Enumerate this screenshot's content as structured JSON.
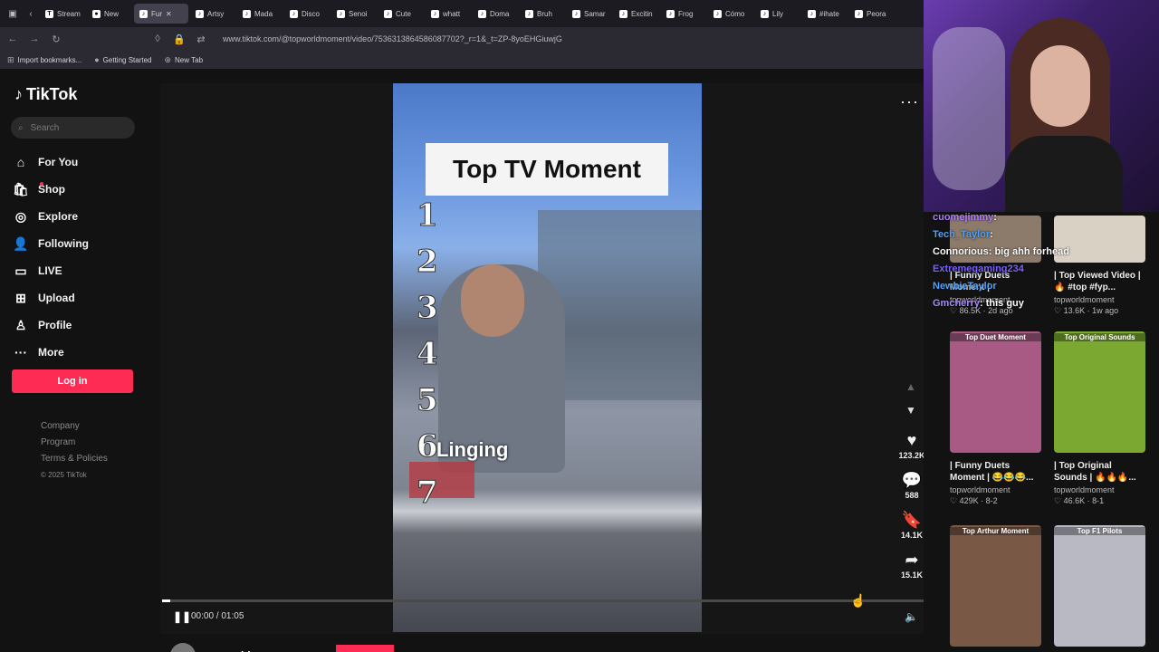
{
  "browser": {
    "tabs": [
      {
        "label": "Stream",
        "fav": "T"
      },
      {
        "label": "New",
        "fav": "●"
      },
      {
        "label": "Fur",
        "fav": "♪",
        "active": true
      },
      {
        "label": "Artsy",
        "fav": "♪"
      },
      {
        "label": "Mada",
        "fav": "♪"
      },
      {
        "label": "Disco",
        "fav": "♪"
      },
      {
        "label": "Senoi",
        "fav": "♪"
      },
      {
        "label": "Cute",
        "fav": "♪"
      },
      {
        "label": "whatt",
        "fav": "♪"
      },
      {
        "label": "Doma",
        "fav": "♪"
      },
      {
        "label": "Bruh",
        "fav": "♪"
      },
      {
        "label": "Samar",
        "fav": "♪"
      },
      {
        "label": "Excitin",
        "fav": "♪"
      },
      {
        "label": "Frog",
        "fav": "♪"
      },
      {
        "label": "Cómo",
        "fav": "♪"
      },
      {
        "label": "Lily",
        "fav": "♪"
      },
      {
        "label": "#ihate",
        "fav": "♪"
      },
      {
        "label": "Peora",
        "fav": "♪"
      }
    ],
    "url": "www.tiktok.com/@topworldmoment/video/7536313864586087702?_r=1&_t=ZP-8yoEHGiuwjG",
    "bookmarks": [
      "Import bookmarks...",
      "Getting Started",
      "New Tab"
    ]
  },
  "sidebar": {
    "logo": "TikTok",
    "search_placeholder": "Search",
    "items": [
      {
        "label": "For You",
        "icon": "⌂"
      },
      {
        "label": "Shop",
        "icon": "🛍"
      },
      {
        "label": "Explore",
        "icon": "◎"
      },
      {
        "label": "Following",
        "icon": "👤"
      },
      {
        "label": "LIVE",
        "icon": "▭"
      },
      {
        "label": "Upload",
        "icon": "⊞"
      },
      {
        "label": "Profile",
        "icon": "♙"
      },
      {
        "label": "More",
        "icon": "···"
      }
    ],
    "login": "Log in",
    "footer": [
      "Company",
      "Program",
      "Terms & Policies"
    ],
    "copyright": "© 2025 TikTok"
  },
  "video": {
    "title_overlay": "Top TV Moment",
    "ranks": [
      "1",
      "2",
      "3",
      "4",
      "5",
      "6",
      "7"
    ],
    "name_overlay": "Linging",
    "time": "00:00 / 01:05",
    "progress": 0.01,
    "author": "topworldmoment",
    "actions": [
      {
        "name": "like",
        "icon": "♥",
        "count": "123.2K"
      },
      {
        "name": "comment",
        "icon": "💬",
        "count": "588"
      },
      {
        "name": "save",
        "icon": "🔖",
        "count": "14.1K"
      },
      {
        "name": "share",
        "icon": "➦",
        "count": "15.1K"
      }
    ]
  },
  "chat": [
    {
      "user": "cuomejimmy",
      "msg": ":",
      "cls": "u1"
    },
    {
      "user": "Tech_Taylor",
      "msg": ":",
      "cls": "u2"
    },
    {
      "user": "Connorious",
      "msg": ": big ahh forhead",
      "cls": "u3"
    },
    {
      "user": "Extremegaming234",
      "msg": "",
      "cls": "u4"
    },
    {
      "user": "NewbieTaylor",
      "msg": "",
      "cls": "u2"
    },
    {
      "user": "Gmcherry",
      "msg": ": this guy",
      "cls": "u5"
    }
  ],
  "recommended": [
    {
      "label": "",
      "title": "| Funny Duets Moment |",
      "author": "topworldmoment",
      "stats": "♡ 86.5K · 2d ago",
      "color": "#8c7a6a"
    },
    {
      "label": "",
      "title": "| Top Viewed Video | 🔥 #top #fyp...",
      "author": "topworldmoment",
      "stats": "♡ 13.6K · 1w ago",
      "color": "#d9d2c4"
    },
    {
      "label": "Top Duet Moment",
      "title": "| Funny Duets Moment | 😂😂😂...",
      "author": "topworldmoment",
      "stats": "♡ 429K · 8-2",
      "color": "#a85a84"
    },
    {
      "label": "Top Original Sounds",
      "title": "| Top Original Sounds | 🔥🔥🔥...",
      "author": "topworldmoment",
      "stats": "♡ 46.6K · 8-1",
      "color": "#7aa830"
    },
    {
      "label": "Top Arthur Moment",
      "title": "",
      "author": "",
      "stats": "",
      "color": "#7a5846"
    },
    {
      "label": "Top F1 Pilots",
      "title": "",
      "author": "",
      "stats": "",
      "color": "#b9b9c4"
    }
  ]
}
